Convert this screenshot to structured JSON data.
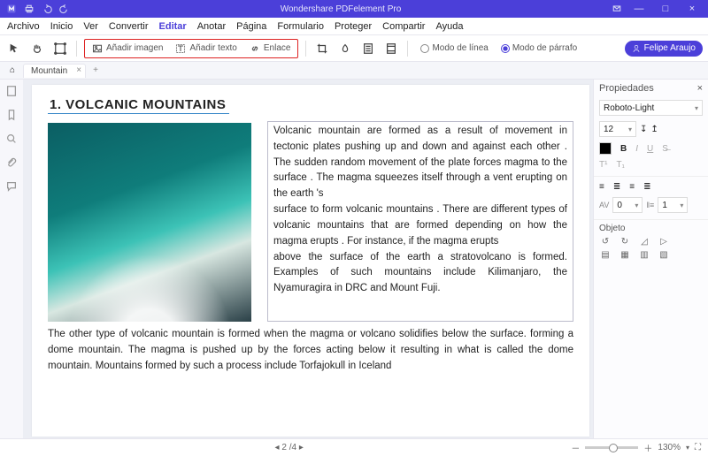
{
  "title": "Wondershare PDFelement Pro",
  "menu": [
    "Archivo",
    "Inicio",
    "Ver",
    "Convertir",
    "Editar",
    "Anotar",
    "Página",
    "Formulario",
    "Proteger",
    "Compartir",
    "Ayuda"
  ],
  "menu_active": "Editar",
  "redbox": {
    "img": "Añadir imagen",
    "text": "Añadir texto",
    "link": "Enlace"
  },
  "mode": {
    "line": "Modo de línea",
    "para": "Modo de párrafo"
  },
  "user": "Felipe Araujo",
  "tab": "Mountain",
  "doc": {
    "heading": "1. VOLCANIC MOUNTAINS",
    "col_text": "Volcanic mountain are formed as a result of movement in tectonic plates pushing up and down and against each other . The sudden random movement  of the plate forces magma  to the surface . The magma squeezes itself through a vent erupting on the earth 's\nsurface to form volcanic mountains . There are different types of volcanic mountains that are formed depending  on how the magma erupts . For instance, if the magma erupts\nabove the surface of the earth a stratovolcano is formed. Examples of such mountains include Kilimanjaro, the Nyamuragira in DRC and Mount Fuji.",
    "below_text": "The other type of volcanic mountain is formed when the magma or volcano solidifies below the surface. forming a dome mountain. The magma is pushed up by the forces acting below it resulting in what is called the dome mountain. Mountains formed by such a process include Torfajokull in Iceland"
  },
  "props": {
    "title": "Propiedades",
    "font": "Roboto-Light",
    "size": "12",
    "letter": "0",
    "line": "1",
    "object": "Objeto"
  },
  "status": {
    "page": "2",
    "total": "4",
    "zoom": "130%"
  }
}
